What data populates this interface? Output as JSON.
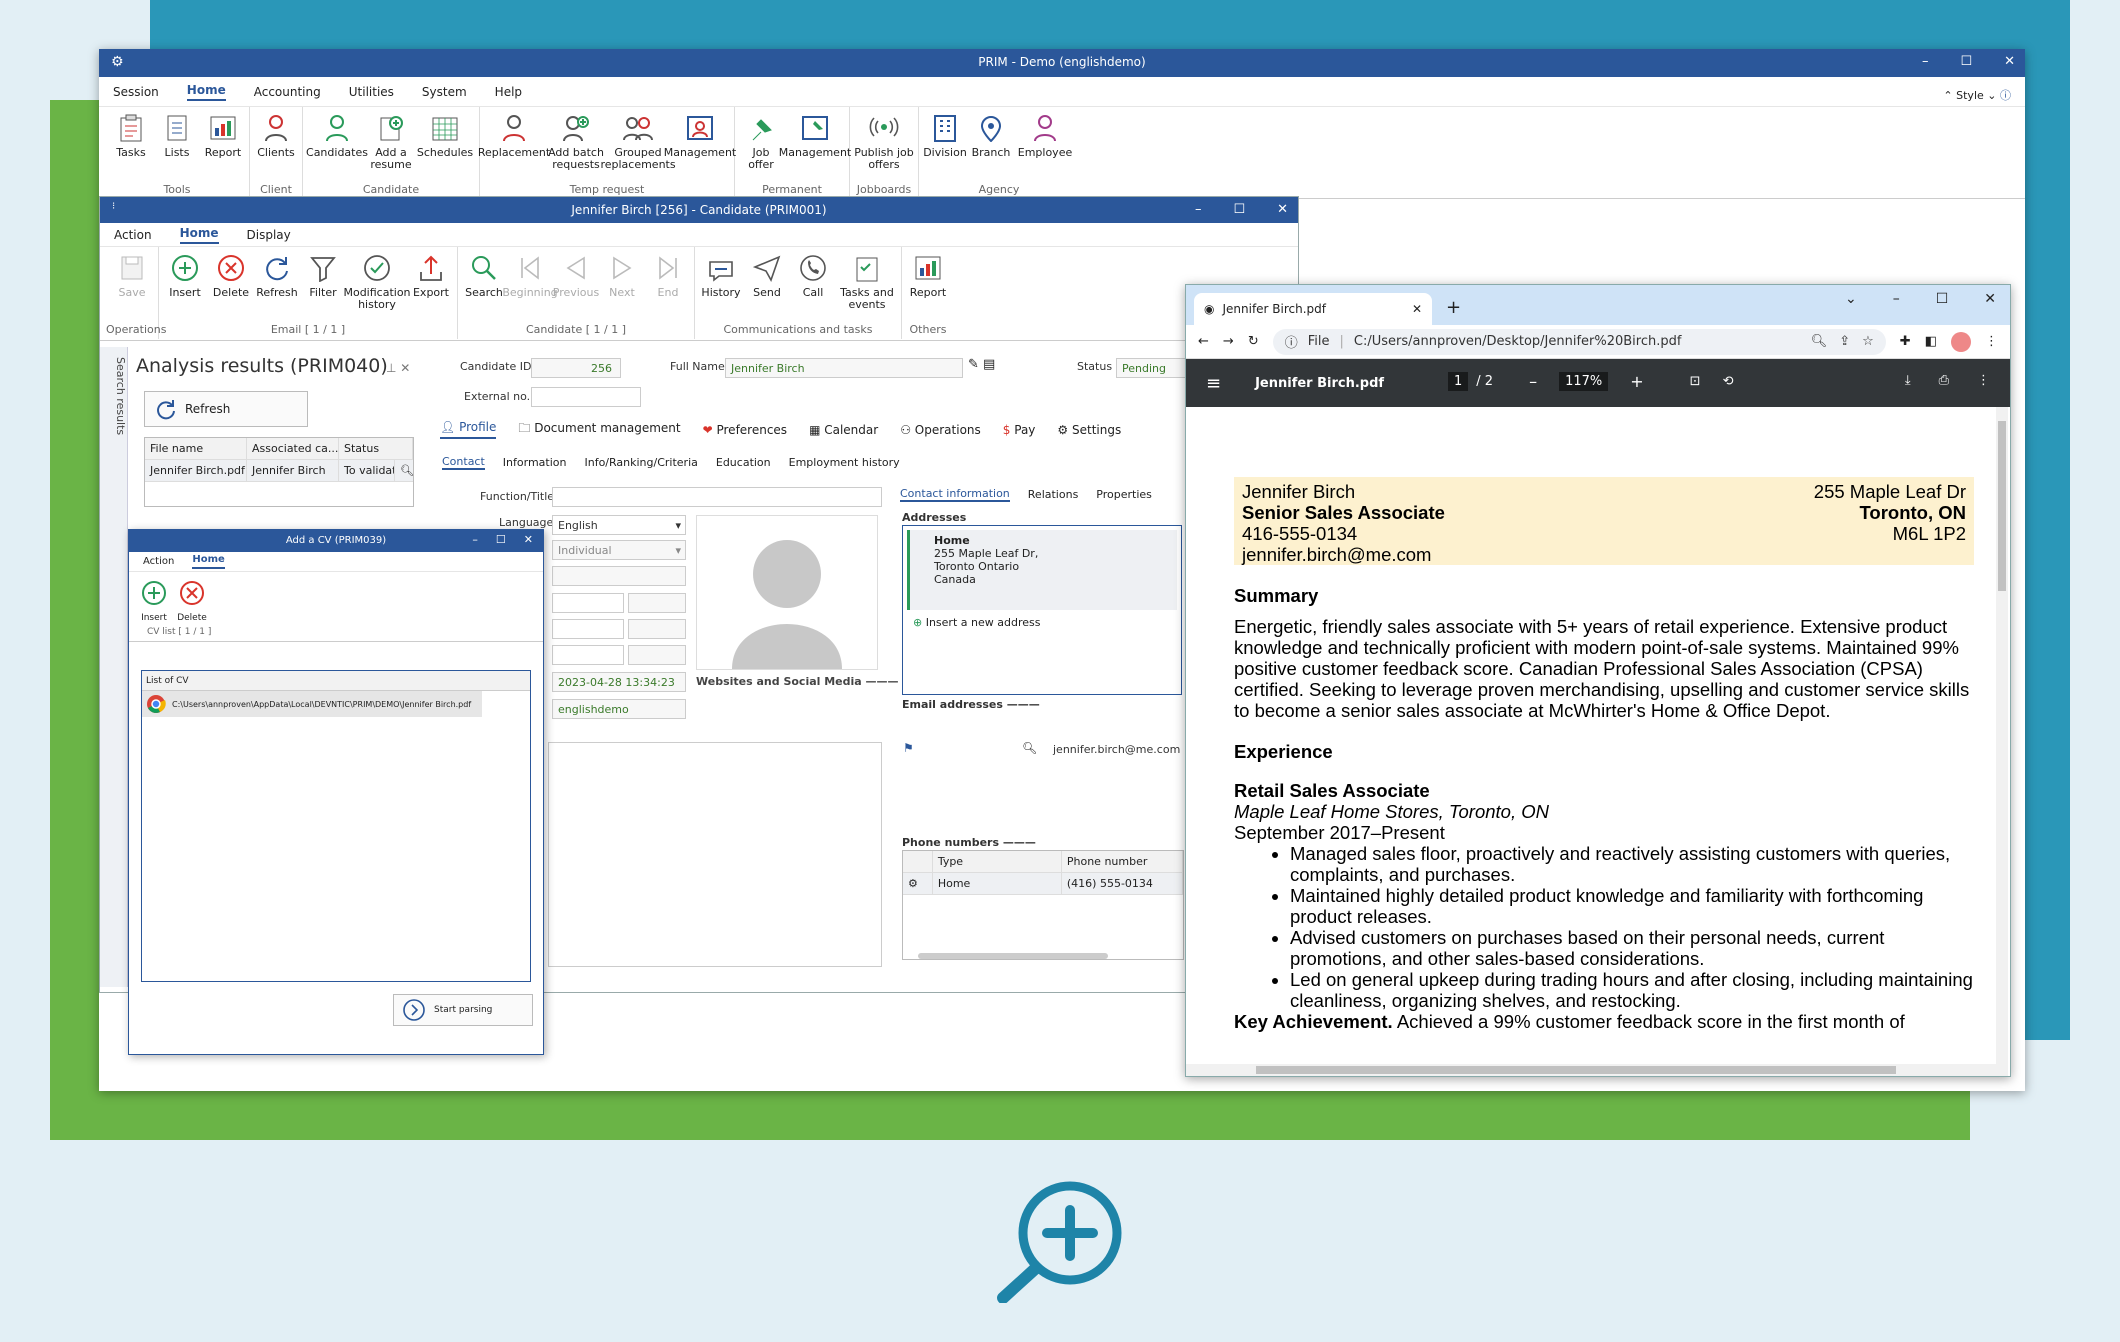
{
  "main": {
    "title": "PRIM - Demo        (englishdemo)",
    "menu": [
      "Session",
      "Home",
      "Accounting",
      "Utilities",
      "System",
      "Help"
    ],
    "style_label": "Style",
    "groups": [
      {
        "label": "Tools",
        "buttons": [
          "Tasks",
          "Lists",
          "Report"
        ]
      },
      {
        "label": "Client",
        "buttons": [
          "Clients"
        ]
      },
      {
        "label": "Candidate",
        "buttons": [
          "Candidates",
          "Add a resume",
          "Schedules"
        ]
      },
      {
        "label": "Temp request",
        "buttons": [
          "Replacement",
          "Add batch requests",
          "Grouped replacements",
          "Management"
        ]
      },
      {
        "label": "Permanent",
        "buttons": [
          "Job offer",
          "Management"
        ]
      },
      {
        "label": "Jobboards",
        "buttons": [
          "Publish job offers"
        ]
      },
      {
        "label": "Agency",
        "buttons": [
          "Division",
          "Branch",
          "Employee"
        ]
      }
    ]
  },
  "candidate": {
    "title": "Jennifer Birch [256] - Candidate (PRIM001)",
    "menu": [
      "Action",
      "Home",
      "Display"
    ],
    "groups": [
      {
        "label": "Operations",
        "buttons": [
          "Save"
        ]
      },
      {
        "label": "Email [ 1 / 1 ]",
        "buttons": [
          "Insert",
          "Delete",
          "Refresh",
          "Filter",
          "Modification history",
          "Export"
        ]
      },
      {
        "label": "Candidate [ 1 / 1 ]",
        "buttons": [
          "Search",
          "Beginning",
          "Previous",
          "Next",
          "End"
        ]
      },
      {
        "label": "Communications and tasks",
        "buttons": [
          "History",
          "Send",
          "Call",
          "Tasks and events"
        ]
      },
      {
        "label": "Others",
        "buttons": [
          "Report"
        ]
      }
    ],
    "side_tab": "Search results",
    "analysis_title": "Analysis results (PRIM040)",
    "refresh": "Refresh",
    "grid_headers": [
      "File name",
      "Associated ca...",
      "Status"
    ],
    "grid_row": [
      "Jennifer Birch.pdf",
      "Jennifer Birch",
      "To validate"
    ],
    "candidate_id_label": "Candidate ID",
    "candidate_id": "256",
    "full_name_label": "Full Name",
    "full_name": "Jennifer Birch",
    "status_label": "Status",
    "status": "Pending",
    "external_label": "External no.",
    "tabs": [
      "Profile",
      "Document management",
      "Preferences",
      "Calendar",
      "Operations",
      "Pay",
      "Settings"
    ],
    "subtabs": [
      "Contact",
      "Information",
      "Info/Ranking/Criteria",
      "Education",
      "Employment history"
    ],
    "function_label": "Function/Title",
    "language_label": "Language",
    "language": "English",
    "type_value": "Individual",
    "date_value": "2023-04-28 13:34:23",
    "user_value": "englishdemo",
    "websites_label": "Websites and Social Media",
    "contact_tabs": [
      "Contact information",
      "Relations",
      "Properties"
    ],
    "addresses_label": "Addresses",
    "address": {
      "title": "Home",
      "line1": "255 Maple Leaf Dr,",
      "line2": "Toronto Ontario",
      "line3": "Canada"
    },
    "insert_address": "Insert a new address",
    "email_label": "Email addresses",
    "email": "jennifer.birch@me.com",
    "phone_label": "Phone numbers",
    "phone_headers": [
      "Type",
      "Phone number"
    ],
    "phone_row": [
      "Home",
      "(416) 555-0134"
    ]
  },
  "dialog": {
    "title": "Add a CV (PRIM039)",
    "menu": [
      "Action",
      "Home"
    ],
    "buttons": [
      "Insert",
      "Delete"
    ],
    "group_label": "CV list [ 1 / 1 ]",
    "list_label": "List of CV",
    "file_path": "C:\\Users\\annproven\\AppData\\Local\\DEVNTIC\\PRIM\\DEMO\\Jennifer Birch.pdf",
    "start": "Start parsing"
  },
  "browser": {
    "tab_title": "Jennifer Birch.pdf",
    "file_label": "File",
    "url": "C:/Users/annproven/Desktop/Jennifer%20Birch.pdf",
    "pdf_title": "Jennifer Birch.pdf",
    "page_current": "1",
    "page_total": "/  2",
    "zoom": "117%"
  },
  "resume": {
    "name": "Jennifer Birch",
    "address1": "255 Maple Leaf Dr",
    "role": "Senior Sales Associate",
    "city": "Toronto, ON",
    "phone": "416-555-0134",
    "postal": "M6L 1P2",
    "email": "jennifer.birch@me.com",
    "summary_h": "Summary",
    "summary": "Energetic, friendly sales associate with 5+ years of retail experience. Extensive product knowledge and technically proficient with modern point-of-sale systems. Maintained 99% positive customer feedback score. Canadian Professional Sales Association (CPSA) certified. Seeking to leverage proven merchandising, upselling and customer service skills to become a senior sales associate at McWhirter's Home & Office Depot.",
    "experience_h": "Experience",
    "job_title": "Retail Sales Associate",
    "company": "Maple Leaf Home Stores, Toronto, ON",
    "dates": "September 2017–Present",
    "bullets": [
      "Managed sales floor, proactively and reactively assisting customers with queries, complaints, and purchases.",
      "Maintained highly detailed product knowledge and familiarity with forthcoming product releases.",
      "Advised customers on purchases based on their personal needs, current promotions, and other sales-based considerations.",
      "Led on general upkeep during trading hours and after closing, including maintaining cleanliness, organizing shelves, and restocking."
    ],
    "key_label": "Key Achievement.",
    "key_text": "Achieved a 99% customer feedback score in the first month of"
  },
  "colors": {
    "accent": "#2b579a",
    "teal": "#2a97b8",
    "green": "#6ab446",
    "icon_green": "#2a9a5a",
    "icon_red": "#d9342b"
  }
}
